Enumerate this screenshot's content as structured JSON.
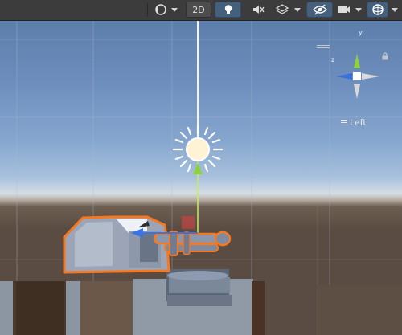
{
  "toolbar": {
    "buttons": [
      {
        "id": "draw-mode",
        "icon": "shading-mode-icon",
        "has_dropdown": true
      },
      {
        "id": "2d-toggle",
        "label": "2D"
      },
      {
        "id": "lighting-toggle",
        "icon": "light-bulb-icon",
        "active": true
      },
      {
        "id": "audio-toggle",
        "icon": "audio-muted-icon"
      },
      {
        "id": "effects-toggle",
        "icon": "effects-layers-icon",
        "has_dropdown": true
      },
      {
        "id": "hidden-objects",
        "icon": "eye-slash-icon",
        "active": true
      },
      {
        "id": "camera-settings",
        "icon": "camera-icon",
        "has_dropdown": true
      },
      {
        "id": "gizmos",
        "icon": "gizmos-icon",
        "active": true,
        "has_dropdown": true
      }
    ]
  },
  "scene": {
    "orientation_gizmo": {
      "view_label": "Left",
      "axis_labels": {
        "y": "y",
        "z": "z"
      },
      "colors": {
        "y": "#8fd13a",
        "z": "#3a6fe0",
        "x": "#d8d8d8"
      }
    },
    "selection_color": "#f7781e",
    "light_icon": "directional-light-sun-icon"
  }
}
